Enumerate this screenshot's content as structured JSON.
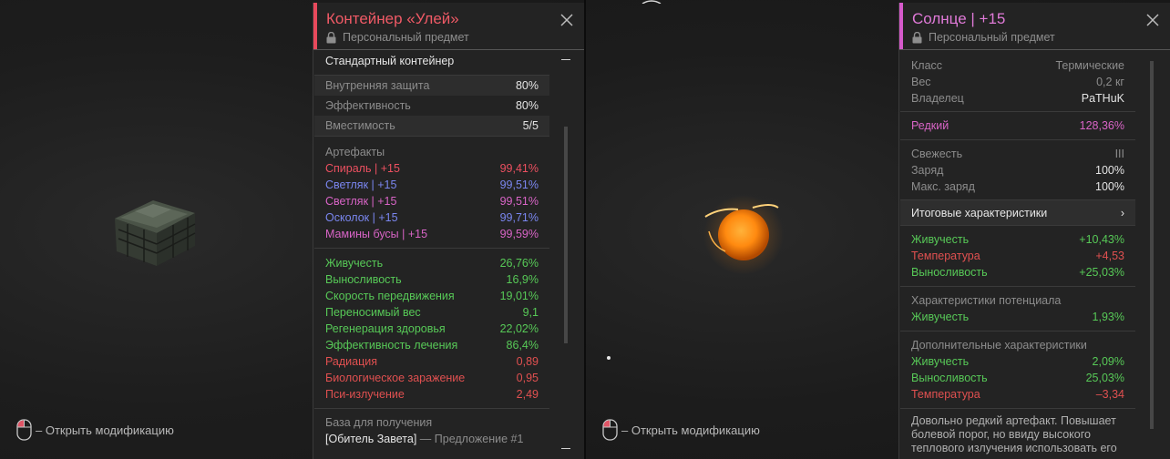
{
  "left": {
    "hint": "– Открыть модификацию",
    "panel": {
      "title": "Контейнер «Улей»",
      "personal": "Персональный предмет",
      "type": "Стандартный контейнер",
      "stats": [
        {
          "label": "Внутренняя защита",
          "value": "80%"
        },
        {
          "label": "Эффективность",
          "value": "80%"
        },
        {
          "label": "Вместимость",
          "value": "5/5"
        }
      ],
      "artifacts_header": "Артефакты",
      "artifacts": [
        {
          "name": "Спираль",
          "level": "+15",
          "value": "99,41%",
          "color": "#ec5060"
        },
        {
          "name": "Светляк",
          "level": "+15",
          "value": "99,51%",
          "color": "#7a86ef"
        },
        {
          "name": "Светляк",
          "level": "+15",
          "value": "99,51%",
          "color": "#d864c6"
        },
        {
          "name": "Осколок",
          "level": "+15",
          "value": "99,71%",
          "color": "#7a86ef"
        },
        {
          "name": "Мамины бусы",
          "level": "+15",
          "value": "99,59%",
          "color": "#d864c6"
        }
      ],
      "effects": [
        {
          "label": "Живучесть",
          "value": "26,76%",
          "kind": "good"
        },
        {
          "label": "Выносливость",
          "value": "16,9%",
          "kind": "good"
        },
        {
          "label": "Скорость передвижения",
          "value": "19,01%",
          "kind": "good"
        },
        {
          "label": "Переносимый вес",
          "value": "9,1",
          "kind": "good"
        },
        {
          "label": "Регенерация здоровья",
          "value": "22,02%",
          "kind": "good"
        },
        {
          "label": "Эффективность лечения",
          "value": "86,4%",
          "kind": "good"
        },
        {
          "label": "Радиация",
          "value": "0,89",
          "kind": "bad"
        },
        {
          "label": "Биологическое заражение",
          "value": "0,95",
          "kind": "bad"
        },
        {
          "label": "Пси-излучение",
          "value": "2,49",
          "kind": "bad"
        }
      ],
      "source_header": "База для получения",
      "source_place": "[Обитель Завета]",
      "source_offer": "— Предложение #1"
    }
  },
  "right": {
    "hint": "– Открыть модификацию",
    "panel": {
      "title": "Солнце | +15",
      "personal": "Персональный предмет",
      "info": [
        {
          "label": "Класс",
          "value": "Термические"
        },
        {
          "label": "Вес",
          "value": "0,2 кг"
        },
        {
          "label": "Владелец",
          "value": "PaTHuK"
        }
      ],
      "rarity": {
        "label": "Редкий",
        "value": "128,36%"
      },
      "condition": [
        {
          "label": "Свежесть",
          "value": "III"
        },
        {
          "label": "Заряд",
          "value": "100%"
        },
        {
          "label": "Макс. заряд",
          "value": "100%"
        }
      ],
      "summary_label": "Итоговые характеристики",
      "summary_arrow": "›",
      "totals": [
        {
          "label": "Живучесть",
          "value": "+10,43%",
          "kind": "good"
        },
        {
          "label": "Температура",
          "value": "+4,53",
          "kind": "bad"
        },
        {
          "label": "Выносливость",
          "value": "+25,03%",
          "kind": "good"
        }
      ],
      "potential_header": "Характеристики потенциала",
      "potential": [
        {
          "label": "Живучесть",
          "value": "1,93%",
          "kind": "good"
        }
      ],
      "extra_header": "Дополнительные характеристики",
      "extra": [
        {
          "label": "Живучесть",
          "value": "2,09%",
          "kind": "good"
        },
        {
          "label": "Выносливость",
          "value": "25,03%",
          "kind": "good"
        },
        {
          "label": "Температура",
          "value": "–3,34",
          "kind": "bad"
        }
      ],
      "description": "Довольно редкий артефакт. Повышает болевой порог, но ввиду высокого теплового излучения использовать его"
    }
  },
  "colors": {
    "left_accent": "#e8495c",
    "right_accent": "#d65acb",
    "good": "#57c957",
    "bad": "#e05050"
  },
  "icons": [
    "mouse-icon",
    "lock-icon",
    "close-icon",
    "chevron-right-icon"
  ]
}
